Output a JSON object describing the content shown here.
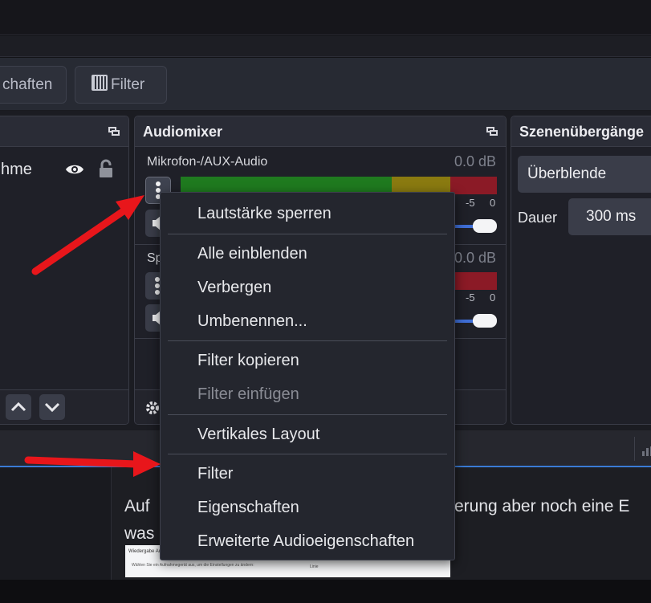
{
  "toolbar": {
    "properties_label": "chaften",
    "filter_label": "Filter"
  },
  "sources_dock": {
    "item_label": "hme"
  },
  "audiomixer": {
    "title": "Audiomixer",
    "channels": [
      {
        "name": "Mikrofon-/AUX-Audio",
        "db": "0.0 dB",
        "tick_a": "-5",
        "tick_b": "0"
      },
      {
        "name": "Sp",
        "db": "0.0 dB",
        "tick_a": "-5",
        "tick_b": "0"
      }
    ]
  },
  "transitions_dock": {
    "title": "Szenenübergänge",
    "transition_value": "Überblende",
    "duration_label": "Dauer",
    "duration_value": "300 ms"
  },
  "content": {
    "line1_left": "Auf",
    "line1_right": "erung aber noch eine E",
    "line2": "was",
    "thumb_text1": "Wiedergabe  Au",
    "thumb_text2": "Wählen Sie ein Aufnahmegerät aus, um die Einstellungen zu ändern:",
    "thumb_text3": "Linie"
  },
  "context_menu": {
    "items": [
      {
        "label": "Lautstärke sperren",
        "enabled": true
      },
      {
        "label": "Alle einblenden",
        "enabled": true
      },
      {
        "label": "Verbergen",
        "enabled": true
      },
      {
        "label": "Umbenennen...",
        "enabled": true
      },
      {
        "label": "Filter kopieren",
        "enabled": true
      },
      {
        "label": "Filter einfügen",
        "enabled": false
      },
      {
        "label": "Vertikales Layout",
        "enabled": true
      },
      {
        "label": "Filter",
        "enabled": true
      },
      {
        "label": "Eigenschaften",
        "enabled": true
      },
      {
        "label": "Erweiterte Audioeigenschaften",
        "enabled": true
      }
    ]
  },
  "colors": {
    "accent_blue": "#3a7bd5",
    "meter_green": "#1f7a1f",
    "meter_yellow": "#8a7a10",
    "meter_red": "#8b1a26",
    "annotation_red": "#e8161b"
  }
}
